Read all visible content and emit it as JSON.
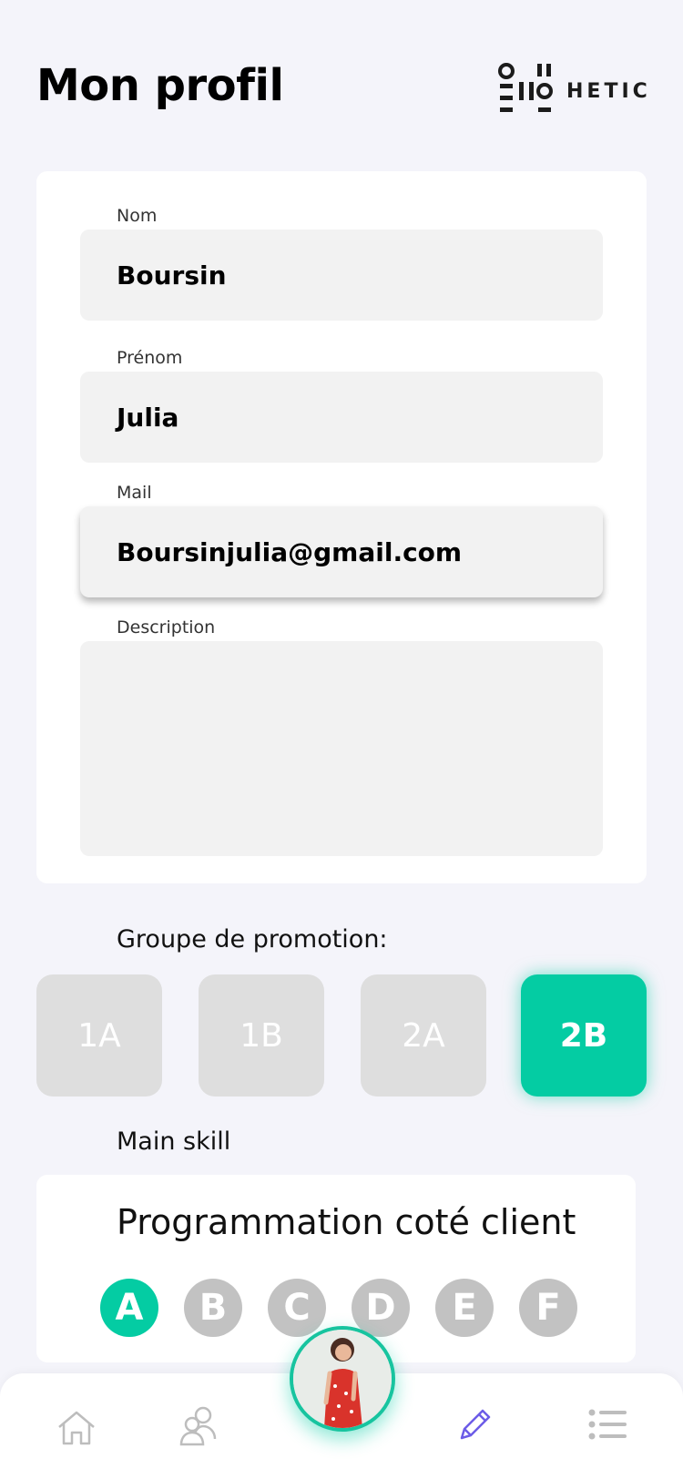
{
  "header": {
    "title": "Mon profil",
    "logo_text": "HETIC"
  },
  "form": {
    "nom": {
      "label": "Nom",
      "value": "Boursin"
    },
    "prenom": {
      "label": "Prénom",
      "value": "Julia"
    },
    "mail": {
      "label": "Mail",
      "value": "Boursinjulia@gmail.com"
    },
    "description": {
      "label": "Description",
      "value": ""
    }
  },
  "promotion": {
    "label": "Groupe de promotion:",
    "options": [
      "1A",
      "1B",
      "2A",
      "2B"
    ],
    "selected": "2B"
  },
  "skill": {
    "label": "Main skill",
    "name": "Programmation coté client",
    "grades": [
      "A",
      "B",
      "C",
      "D",
      "E",
      "F"
    ],
    "selected": "A"
  },
  "nav": {
    "items": [
      {
        "icon": "home-icon"
      },
      {
        "icon": "users-icon"
      },
      {
        "icon": "avatar"
      },
      {
        "icon": "pencil-icon",
        "active": true
      },
      {
        "icon": "list-icon"
      }
    ]
  },
  "colors": {
    "accent": "#04cca3",
    "nav_active": "#6c5ce7",
    "inactive": "#dedede"
  }
}
